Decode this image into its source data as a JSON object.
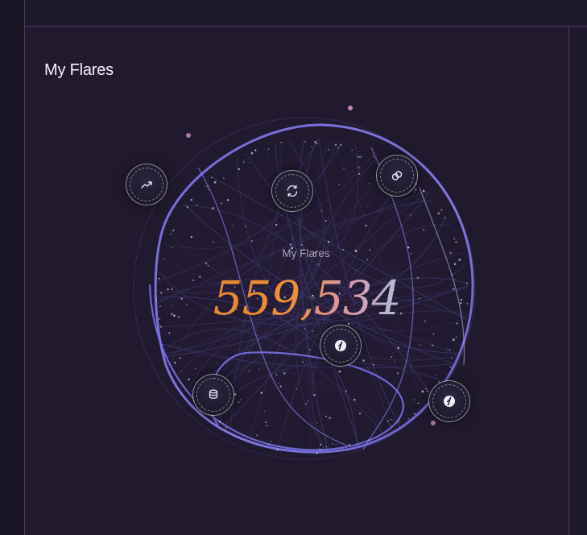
{
  "panel": {
    "title": "My Flares"
  },
  "globe": {
    "label": "My Flares",
    "value": "559,534"
  },
  "orbs": [
    {
      "name": "trending-up-orb",
      "icon": "trending-up-icon"
    },
    {
      "name": "refresh-orb",
      "icon": "refresh-icon"
    },
    {
      "name": "link-orb",
      "icon": "link-icon"
    },
    {
      "name": "flare-orb-center",
      "icon": "flare-slash-icon"
    },
    {
      "name": "coins-orb",
      "icon": "coins-stack-icon"
    },
    {
      "name": "flare-orb-right",
      "icon": "flare-slash-icon"
    }
  ],
  "colors": {
    "background": "#211a2f",
    "border": "#4b3a6b",
    "globe_accent": "#7b72e8",
    "number_orange": "#e8862e",
    "number_blue": "#a8c8dc"
  }
}
